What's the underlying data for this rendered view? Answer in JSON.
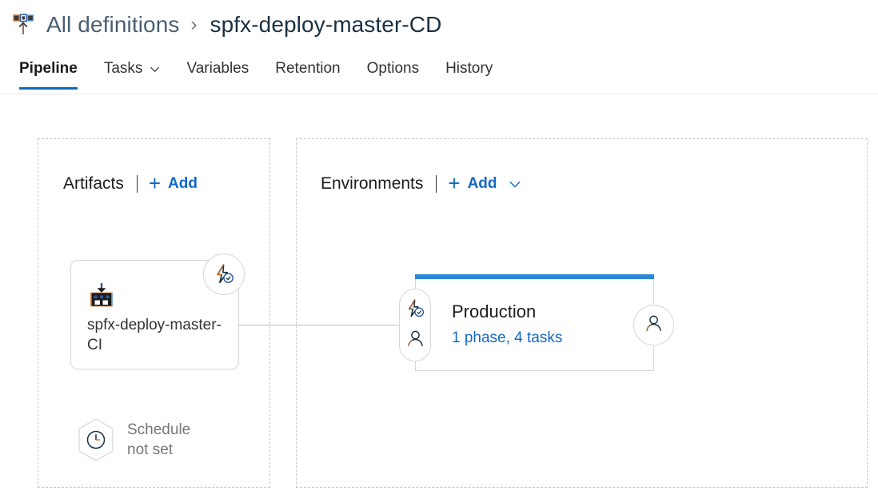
{
  "breadcrumb": {
    "icon": "release-definition-icon",
    "parent_label": "All definitions",
    "separator": "›",
    "current_label": "spfx-deploy-master-CD"
  },
  "tabs": [
    {
      "label": "Pipeline",
      "active": true,
      "has_caret": false
    },
    {
      "label": "Tasks",
      "active": false,
      "has_caret": true
    },
    {
      "label": "Variables",
      "active": false,
      "has_caret": false
    },
    {
      "label": "Retention",
      "active": false,
      "has_caret": false
    },
    {
      "label": "Options",
      "active": false,
      "has_caret": false
    },
    {
      "label": "History",
      "active": false,
      "has_caret": false
    }
  ],
  "artifacts": {
    "title": "Artifacts",
    "divider": "|",
    "add_plus": "+",
    "add_label": "Add",
    "card": {
      "icon": "build-artifact-icon",
      "name": "spfx-deploy-master-CI",
      "trigger_badge_icon": "continuous-deployment-trigger-icon"
    },
    "schedule": {
      "icon": "schedule-clock-icon",
      "label_line1": "Schedule",
      "label_line2": "not set"
    }
  },
  "environments": {
    "title": "Environments",
    "divider": "|",
    "add_plus": "+",
    "add_label": "Add",
    "add_caret_icon": "chevron-down-icon",
    "card": {
      "name": "Production",
      "summary": "1 phase, 4 tasks",
      "pre_deployment_trigger_icon": "continuous-deployment-trigger-icon",
      "pre_deployment_approval_icon": "person-icon",
      "post_deployment_approval_icon": "person-icon"
    }
  },
  "colors": {
    "accent_blue": "#2b88d8",
    "link_blue": "#1268c3",
    "tab_underline": "#0b6cb8",
    "panel_dash": "#c8c8c8",
    "card_border": "#d6d6d6",
    "muted_text": "#767676",
    "breadcrumb_link": "#4a6072",
    "icon_dark": "#1b3040",
    "icon_orange": "#d4762c"
  }
}
